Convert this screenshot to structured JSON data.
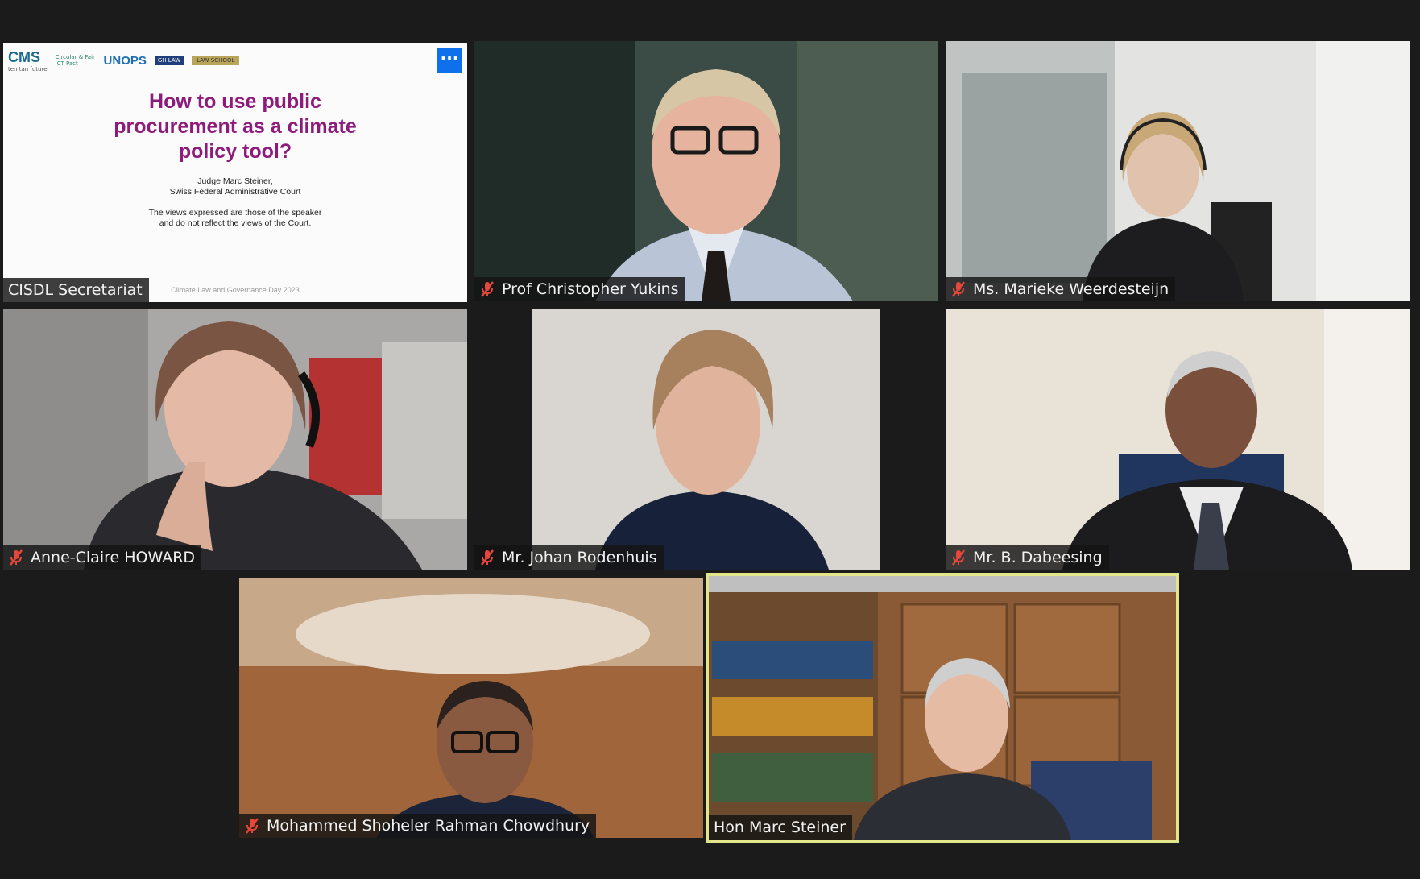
{
  "participants": [
    {
      "name": "CISDL Secretariat",
      "muted": false,
      "active": false,
      "shares_screen": true
    },
    {
      "name": "Prof Christopher Yukins",
      "muted": true,
      "active": false
    },
    {
      "name": "Ms. Marieke Weerdesteijn",
      "muted": true,
      "active": false
    },
    {
      "name": "Anne-Claire HOWARD",
      "muted": true,
      "active": false
    },
    {
      "name": "Mr. Johan Rodenhuis",
      "muted": true,
      "active": false
    },
    {
      "name": "Mr. B. Dabeesing",
      "muted": true,
      "active": false
    },
    {
      "name": "Mohammed Shoheler Rahman Chowdhury",
      "muted": true,
      "active": false
    },
    {
      "name": "Hon Marc Steiner",
      "muted": false,
      "active": true
    }
  ],
  "shared_slide": {
    "logos": {
      "cms": "CMS",
      "cms_sub": "ten tan future",
      "partner": "Circular & Fair ICT Pact",
      "unops": "UNOPS",
      "box1": "GH LAW",
      "box2": "LAW SCHOOL"
    },
    "more_button": "···",
    "title": "How to use public\nprocurement as a climate\npolicy tool?",
    "speaker": "Judge Marc Steiner,",
    "affiliation": "Swiss Federal Administrative Court",
    "disclaimer_1": "The views expressed are those of the speaker",
    "disclaimer_2": "and do not reflect the views of the Court.",
    "footer": "Climate Law and Governance Day 2023"
  },
  "colors": {
    "background": "#1b1b1b",
    "active_speaker_border": "#e3e58a",
    "mute_icon": "#e5483b",
    "slide_title": "#8e1b7c",
    "more_button": "#0e71eb"
  }
}
